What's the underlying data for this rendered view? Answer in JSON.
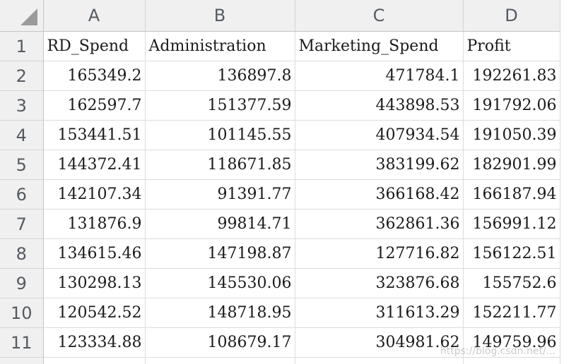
{
  "column_headers": [
    "A",
    "B",
    "C",
    "D"
  ],
  "header_row": {
    "row_number": "1",
    "cells": [
      "RD_Spend",
      "Administration",
      "Marketing_Spend",
      "Profit"
    ]
  },
  "rows": [
    {
      "row_number": "2",
      "cells": [
        "165349.2",
        "136897.8",
        "471784.1",
        "192261.83"
      ]
    },
    {
      "row_number": "3",
      "cells": [
        "162597.7",
        "151377.59",
        "443898.53",
        "191792.06"
      ]
    },
    {
      "row_number": "4",
      "cells": [
        "153441.51",
        "101145.55",
        "407934.54",
        "191050.39"
      ]
    },
    {
      "row_number": "5",
      "cells": [
        "144372.41",
        "118671.85",
        "383199.62",
        "182901.99"
      ]
    },
    {
      "row_number": "6",
      "cells": [
        "142107.34",
        "91391.77",
        "366168.42",
        "166187.94"
      ]
    },
    {
      "row_number": "7",
      "cells": [
        "131876.9",
        "99814.71",
        "362861.36",
        "156991.12"
      ]
    },
    {
      "row_number": "8",
      "cells": [
        "134615.46",
        "147198.87",
        "127716.82",
        "156122.51"
      ]
    },
    {
      "row_number": "9",
      "cells": [
        "130298.13",
        "145530.06",
        "323876.68",
        "155752.6"
      ]
    },
    {
      "row_number": "10",
      "cells": [
        "120542.52",
        "148718.95",
        "311613.29",
        "152211.77"
      ]
    },
    {
      "row_number": "11",
      "cells": [
        "123334.88",
        "108679.17",
        "304981.62",
        "149759.96"
      ]
    }
  ],
  "watermark": "https://blog.csdn.net/..."
}
